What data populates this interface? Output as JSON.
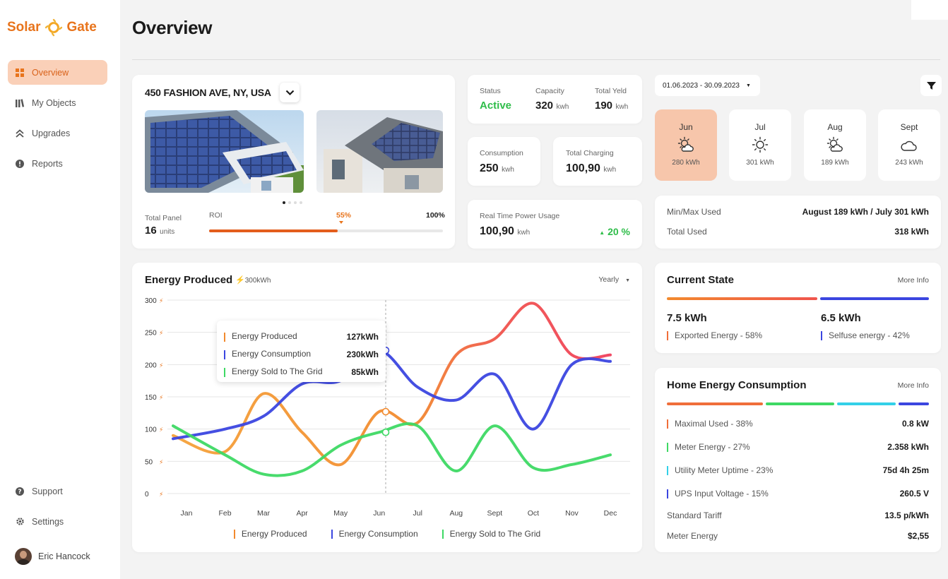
{
  "app": {
    "brand_left": "Solar",
    "brand_right": "Gate"
  },
  "sidebar": {
    "items": [
      {
        "label": "Overview",
        "icon": "grid-icon",
        "active": true
      },
      {
        "label": "My Objects",
        "icon": "books-icon"
      },
      {
        "label": "Upgrades",
        "icon": "double-chevron-up-icon"
      },
      {
        "label": "Reports",
        "icon": "alert-circle-icon"
      }
    ],
    "bottom": [
      {
        "label": "Support",
        "icon": "help-icon"
      },
      {
        "label": "Settings",
        "icon": "gear-icon"
      }
    ],
    "user": {
      "name": "Eric Hancock"
    }
  },
  "page": {
    "title": "Overview"
  },
  "property": {
    "address": "450 FASHION AVE, NY, USA",
    "total_panel_label": "Total Panel",
    "total_panel_value": "16",
    "total_panel_unit": "units",
    "roi_label": "ROI",
    "roi_value": "55%",
    "roi_max": "100%",
    "roi_fraction": 0.55,
    "carousel_active": 1,
    "carousel_count": 4
  },
  "status": {
    "status_label": "Status",
    "status_value": "Active",
    "capacity_label": "Capacity",
    "capacity_value": "320",
    "capacity_unit": "kwh",
    "yield_label": "Total Yeld",
    "yield_value": "190",
    "yield_unit": "kwh"
  },
  "consumption": {
    "label": "Consumption",
    "value": "250",
    "unit": "kwh"
  },
  "charging": {
    "label": "Total Charging",
    "value": "100,90",
    "unit": "kwh"
  },
  "realtime": {
    "label": "Real Time Power Usage",
    "value": "100,90",
    "unit": "kwh",
    "change": "20 %"
  },
  "date_range": {
    "value": "01.06.2023 - 30.09.2023"
  },
  "months": [
    {
      "name": "Jun",
      "value": "280 kWh",
      "icon": "sun-cloud-icon",
      "selected": true
    },
    {
      "name": "Jul",
      "value": "301 kWh",
      "icon": "sun-icon"
    },
    {
      "name": "Aug",
      "value": "189 kWh",
      "icon": "sun-cloud-icon"
    },
    {
      "name": "Sept",
      "value": "243 kWh",
      "icon": "cloud-icon"
    }
  ],
  "minmax": {
    "label": "Min/Max Used",
    "value": "August 189 kWh / July 301 kWh",
    "total_label": "Total Used",
    "total_value": "318 kWh"
  },
  "energy_chart": {
    "title": "Energy Produced",
    "badge": "300kWh",
    "period": "Yearly"
  },
  "chart_data": {
    "type": "line",
    "x": [
      "Jan",
      "Feb",
      "Mar",
      "Apr",
      "May",
      "Jun",
      "Jul",
      "Aug",
      "Sept",
      "Oct",
      "Nov",
      "Dec"
    ],
    "ylim": [
      0,
      300
    ],
    "yticks": [
      0,
      50,
      100,
      150,
      200,
      250,
      300
    ],
    "series": [
      {
        "name": "Energy Produced",
        "color": "#f28a2e",
        "values": [
          90,
          65,
          155,
          95,
          45,
          127,
          110,
          215,
          240,
          295,
          215,
          215
        ]
      },
      {
        "name": "Energy Consumption",
        "color": "#3b46e0",
        "values": [
          85,
          100,
          120,
          170,
          175,
          222,
          165,
          145,
          185,
          100,
          200,
          205
        ]
      },
      {
        "name": "Energy Sold to The Grid",
        "color": "#3ed964",
        "values": [
          105,
          60,
          30,
          35,
          75,
          95,
          105,
          35,
          105,
          40,
          45,
          60
        ]
      }
    ],
    "tooltip": {
      "rows": [
        {
          "name": "Energy Produced",
          "value": "127kWh"
        },
        {
          "name": "Energy Consumption",
          "value": "230kWh"
        },
        {
          "name": "Energy Sold to The Grid",
          "value": "85kWh"
        }
      ]
    },
    "legend_position": "bottom",
    "grid": true
  },
  "current_state": {
    "title": "Current State",
    "more": "More Info",
    "exported_value": "7.5 kWh",
    "exported_label": "Exported Energy - 58%",
    "exported_fraction": 0.58,
    "selfuse_value": "6.5 kWh",
    "selfuse_label": "Selfuse energy - 42%",
    "selfuse_fraction": 0.42
  },
  "home_energy": {
    "title": "Home Energy Consumption",
    "more": "More Info",
    "bars": [
      {
        "fraction": 0.38,
        "color": "#f06e3a"
      },
      {
        "fraction": 0.27,
        "color": "#3ed964"
      },
      {
        "fraction": 0.23,
        "color": "#33d0e8"
      },
      {
        "fraction": 0.12,
        "color": "#3b46e0"
      }
    ],
    "rows": [
      {
        "label": "Maximal Used - 38%",
        "value": "0.8 kW"
      },
      {
        "label": "Meter Energy - 27%",
        "value": "2.358 kWh"
      },
      {
        "label": "Utility Meter Uptime - 23%",
        "value": "75d 4h 25m"
      },
      {
        "label": "UPS Input Voltage - 15%",
        "value": "260.5 V"
      },
      {
        "label": "Standard Tariff",
        "value": "13.5 p/kWh"
      },
      {
        "label": "Meter Energy",
        "value": "$2,55"
      }
    ]
  }
}
